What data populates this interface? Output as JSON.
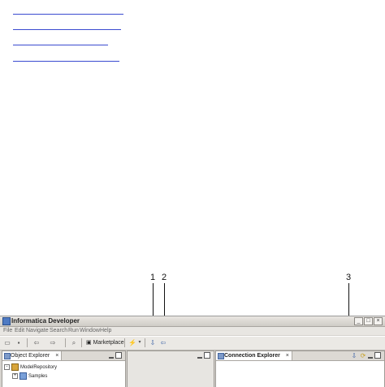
{
  "callouts": {
    "c1": "1",
    "c2": "2",
    "c3": "3"
  },
  "app": {
    "title": "Informatica Developer",
    "window_buttons": {
      "minimize": "_",
      "maximize": "□",
      "close": "×"
    },
    "menu": [
      "File",
      "Edit",
      "Navigate",
      "Search",
      "Run",
      "Window",
      "Help"
    ],
    "toolbar": {
      "marketplace_label": "Marketplace"
    },
    "object_explorer": {
      "tab_label": "Object Explorer",
      "close_label": "×",
      "tree": [
        {
          "label": "ModelRepository",
          "toggle": "-"
        },
        {
          "label": "Samples",
          "toggle": "+"
        }
      ]
    },
    "connection_explorer": {
      "tab_label": "Connection Explorer",
      "close_label": "×"
    }
  },
  "colors": {
    "link": "#3a4bd0",
    "chrome": "#d6d3ce"
  }
}
